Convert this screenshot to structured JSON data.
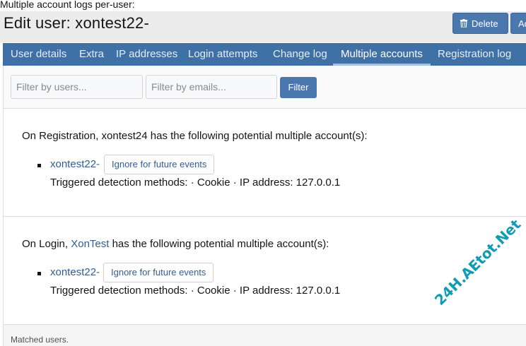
{
  "caption": "Multiple account logs per-user:",
  "header": {
    "title": "Edit user: xontest22-",
    "delete_label": "Delete",
    "add_label": "Ad"
  },
  "tabs": [
    {
      "label": "User details"
    },
    {
      "label": "Extra"
    },
    {
      "label": "IP addresses"
    },
    {
      "label": "Login attempts"
    },
    {
      "label": "Change log"
    },
    {
      "label": "Multiple accounts"
    },
    {
      "label": "Registration log"
    }
  ],
  "active_tab": "Multiple accounts",
  "filters": {
    "users_placeholder": "Filter by users...",
    "emails_placeholder": "Filter by emails...",
    "filter_label": "Filter"
  },
  "events": [
    {
      "prefix": "On Registration, xontest24 has the following potential multiple account(s):",
      "user_link": "",
      "suffix": "",
      "account": "xontest22-",
      "ignore_label": "Ignore for future events",
      "methods": "Triggered detection methods: · Cookie · IP address: 127.0.0.1"
    },
    {
      "prefix": "On Login, ",
      "user_link": "XonTest",
      "suffix": " has the following potential multiple account(s):",
      "account": "xontest22-",
      "ignore_label": "Ignore for future events",
      "methods": "Triggered detection methods: · Cookie · IP address: 127.0.0.1"
    }
  ],
  "footer": {
    "text": "Matched users."
  },
  "watermark": "24H.AEtot.Net",
  "colors": {
    "tab_bar": "#3f70a6",
    "button": "#4a77ad",
    "link": "#2f5e97"
  }
}
